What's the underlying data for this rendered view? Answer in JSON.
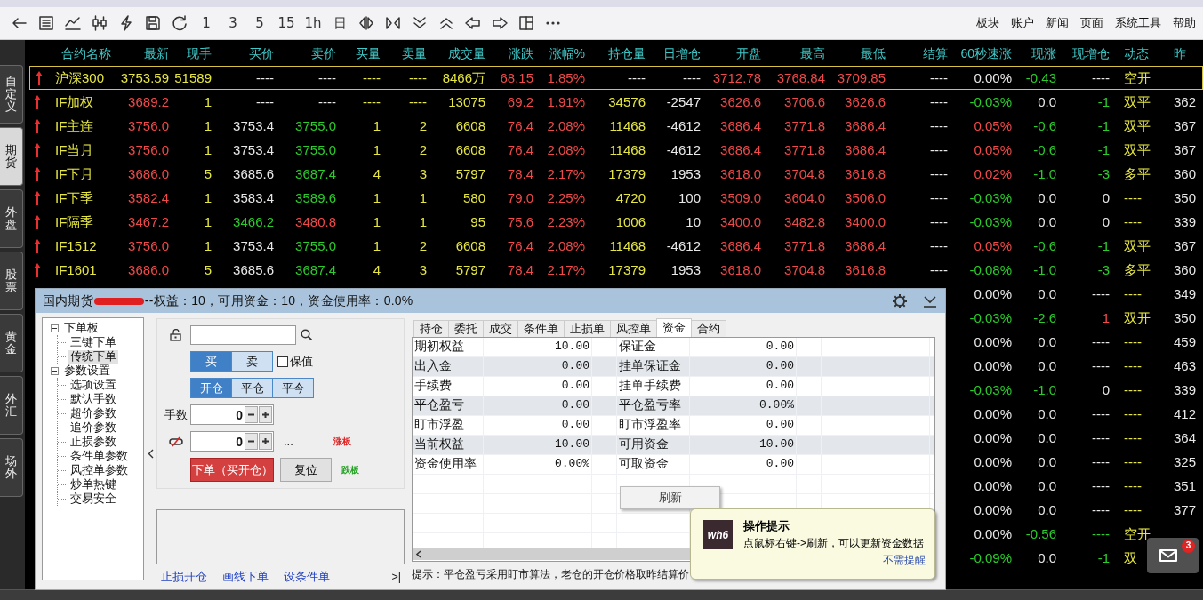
{
  "toolbar": {
    "periods": [
      "1",
      "3",
      "5",
      "15",
      "1h",
      "日"
    ],
    "menu": [
      "板块",
      "账户",
      "新闻",
      "页面",
      "系统工具",
      "帮助"
    ]
  },
  "side_tabs": [
    {
      "label": "自定义",
      "selected": false
    },
    {
      "label": "期货",
      "selected": true
    },
    {
      "label": "外盘",
      "selected": false
    },
    {
      "label": "股票",
      "selected": false
    },
    {
      "label": "黄金",
      "selected": false
    },
    {
      "label": "外汇",
      "selected": false
    },
    {
      "label": "场外",
      "selected": false
    }
  ],
  "quotes": {
    "columns": [
      {
        "label": "合约名称",
        "color": "#e6e642"
      },
      {
        "label": "最新",
        "color": "#f04a4a"
      },
      {
        "label": "现手",
        "color": "#e6e642"
      },
      {
        "label": "买价",
        "color": "#e8e8e8"
      },
      {
        "label": "卖价",
        "color": "#2ccc2c"
      },
      {
        "label": "买量",
        "color": "#e6e642"
      },
      {
        "label": "卖量",
        "color": "#e6e642"
      },
      {
        "label": "成交量",
        "color": "#e6e642"
      },
      {
        "label": "涨跌",
        "color": "#f04a4a"
      },
      {
        "label": "涨幅%",
        "color": "#f04a4a"
      },
      {
        "label": "持仓量",
        "color": "#e6e642"
      },
      {
        "label": "日增仓",
        "color": "#e8e8e8"
      },
      {
        "label": "开盘",
        "color": "#f04a4a"
      },
      {
        "label": "最高",
        "color": "#f04a4a"
      },
      {
        "label": "最低",
        "color": "#f04a4a"
      },
      {
        "label": "结算",
        "color": "#e8e8e8"
      },
      {
        "label": "60秒速涨",
        "color": "#e8e8e8"
      },
      {
        "label": "现涨",
        "color": "#e8e8e8"
      },
      {
        "label": "现增仓",
        "color": "#e8e8e8"
      },
      {
        "label": "动态",
        "color": "#e6e642"
      },
      {
        "label": "昨",
        "color": "#e8e8e8"
      }
    ],
    "rows": [
      {
        "selected": true,
        "kind": "rising",
        "cells": [
          "沪深300",
          {
            "text": "3753.59",
            "color": "#e6e642"
          },
          "51589",
          "----",
          {
            "text": "----",
            "color": "#e8e8e8"
          },
          "----",
          "----",
          "8466万",
          "68.15",
          "1.85%",
          {
            "text": "----",
            "color": "#e8e8e8"
          },
          "----",
          "3712.78",
          "3768.84",
          "3709.85",
          "----",
          "0.00%",
          {
            "text": "-0.43",
            "color": "#2ccc2c"
          },
          "----",
          "空开"
        ]
      },
      {
        "selected": false,
        "kind": "rising",
        "cells": [
          "IF加权",
          "3689.2",
          "1",
          "----",
          {
            "text": "----",
            "color": "#e8e8e8"
          },
          "----",
          "----",
          "13075",
          "69.2",
          "1.91%",
          "34576",
          "-2547",
          "3626.6",
          "3706.6",
          "3626.6",
          "----",
          {
            "text": "-0.03%",
            "color": "#2ccc2c"
          },
          "0.0",
          {
            "text": "-1",
            "color": "#2ccc2c"
          },
          "双平",
          "362"
        ]
      },
      {
        "selected": false,
        "kind": "rising",
        "cells": [
          "IF主连",
          "3756.0",
          "1",
          "3753.4",
          "3755.0",
          "1",
          "2",
          "6608",
          "76.4",
          "2.08%",
          "11468",
          "-4612",
          "3686.4",
          "3771.8",
          "3686.4",
          "----",
          {
            "text": "0.05%",
            "color": "#f04a4a"
          },
          {
            "text": "-0.6",
            "color": "#2ccc2c"
          },
          {
            "text": "-1",
            "color": "#2ccc2c"
          },
          "双平",
          "367"
        ]
      },
      {
        "selected": false,
        "kind": "rising",
        "cells": [
          "IF当月",
          "3756.0",
          "1",
          "3753.4",
          "3755.0",
          "1",
          "2",
          "6608",
          "76.4",
          "2.08%",
          "11468",
          "-4612",
          "3686.4",
          "3771.8",
          "3686.4",
          "----",
          {
            "text": "0.05%",
            "color": "#f04a4a"
          },
          {
            "text": "-0.6",
            "color": "#2ccc2c"
          },
          {
            "text": "-1",
            "color": "#2ccc2c"
          },
          "双平",
          "367"
        ]
      },
      {
        "selected": false,
        "kind": "rising",
        "cells": [
          "IF下月",
          "3686.0",
          "5",
          "3685.6",
          "3687.4",
          "4",
          "3",
          "5797",
          "78.4",
          "2.17%",
          "17379",
          "1953",
          "3618.0",
          "3704.8",
          "3616.8",
          "----",
          {
            "text": "0.02%",
            "color": "#f04a4a"
          },
          {
            "text": "-1.0",
            "color": "#2ccc2c"
          },
          {
            "text": "-3",
            "color": "#2ccc2c"
          },
          "多平",
          "360"
        ]
      },
      {
        "selected": false,
        "kind": "rising",
        "cells": [
          "IF下季",
          "3582.4",
          "1",
          "3583.4",
          "3589.6",
          "1",
          "1",
          "580",
          "79.0",
          "2.25%",
          "4720",
          "100",
          "3509.0",
          "3604.0",
          "3506.0",
          "----",
          {
            "text": "-0.03%",
            "color": "#2ccc2c"
          },
          "0.0",
          "0",
          "----",
          "350"
        ]
      },
      {
        "selected": false,
        "kind": "rising",
        "cells": [
          "IF隔季",
          "3467.2",
          "1",
          {
            "text": "3466.2",
            "color": "#2ccc2c"
          },
          {
            "text": "3480.8",
            "color": "#f04a4a"
          },
          "1",
          "1",
          "95",
          "75.6",
          "2.23%",
          "1006",
          "10",
          "3400.0",
          "3482.8",
          "3400.0",
          "----",
          {
            "text": "-0.03%",
            "color": "#2ccc2c"
          },
          "0.0",
          "0",
          "----",
          "339"
        ]
      },
      {
        "selected": false,
        "kind": "rising",
        "cells": [
          "IF1512",
          "3756.0",
          "1",
          "3753.4",
          "3755.0",
          "1",
          "2",
          "6608",
          "76.4",
          "2.08%",
          "11468",
          "-4612",
          "3686.4",
          "3771.8",
          "3686.4",
          "----",
          {
            "text": "0.05%",
            "color": "#f04a4a"
          },
          {
            "text": "-0.6",
            "color": "#2ccc2c"
          },
          {
            "text": "-1",
            "color": "#2ccc2c"
          },
          "双平",
          "367"
        ]
      },
      {
        "selected": false,
        "kind": "rising",
        "cells": [
          "IF1601",
          "3686.0",
          "5",
          "3685.6",
          "3687.4",
          "4",
          "3",
          "5797",
          "78.4",
          "2.17%",
          "17379",
          "1953",
          "3618.0",
          "3704.8",
          "3616.8",
          "----",
          {
            "text": "-0.08%",
            "color": "#2ccc2c"
          },
          {
            "text": "-1.0",
            "color": "#2ccc2c"
          },
          {
            "text": "-3",
            "color": "#2ccc2c"
          },
          "多平",
          "360"
        ]
      }
    ],
    "rows_behind_dialog": [
      {
        "cells": [
          "0.00%",
          "0.0",
          "----",
          "----",
          "349"
        ]
      },
      {
        "cells": [
          {
            "text": "-0.03%",
            "color": "#2ccc2c"
          },
          {
            "text": "-2.6",
            "color": "#2ccc2c"
          },
          {
            "text": "1",
            "color": "#f04a4a"
          },
          "双开",
          "350"
        ]
      },
      {
        "cells": [
          "0.00%",
          "0.0",
          "----",
          "----",
          "459"
        ]
      },
      {
        "cells": [
          "0.00%",
          "0.0",
          "----",
          "----",
          "463"
        ]
      },
      {
        "cells": [
          {
            "text": "-0.03%",
            "color": "#2ccc2c"
          },
          {
            "text": "-1.0",
            "color": "#2ccc2c"
          },
          "0",
          "----",
          "339"
        ]
      },
      {
        "cells": [
          "0.00%",
          "0.0",
          "----",
          "----",
          "412"
        ]
      },
      {
        "cells": [
          "0.00%",
          "0.0",
          "----",
          "----",
          "364"
        ]
      },
      {
        "cells": [
          "0.00%",
          "0.0",
          "----",
          "----",
          "325"
        ]
      },
      {
        "cells": [
          "0.00%",
          "0.0",
          "----",
          "----",
          "351"
        ]
      },
      {
        "cells": [
          "0.00%",
          "0.0",
          "----",
          "----",
          "377"
        ]
      },
      {
        "cells": [
          "0.00%",
          {
            "text": "-0.56",
            "color": "#2ccc2c"
          },
          {
            "text": "----",
            "color": "#2ccc2c"
          },
          "空开"
        ]
      },
      {
        "cells": [
          {
            "text": "-0.09%",
            "color": "#2ccc2c"
          },
          "0.0",
          {
            "text": "-1",
            "color": "#2ccc2c"
          },
          "双"
        ]
      }
    ]
  },
  "dialog": {
    "title_prefix": "国内期货",
    "title_suffix": "--权益：10，可用资金：10，资金使用率：0.0%",
    "tree": [
      {
        "label": "下单板",
        "expanded": true,
        "children": [
          {
            "label": "三键下单",
            "selected": false
          },
          {
            "label": "传统下单",
            "selected": true
          }
        ]
      },
      {
        "label": "参数设置",
        "expanded": true,
        "children": [
          {
            "label": "选项设置",
            "selected": false
          },
          {
            "label": "默认手数",
            "selected": false
          },
          {
            "label": "超价参数",
            "selected": false
          },
          {
            "label": "追价参数",
            "selected": false
          },
          {
            "label": "止损参数",
            "selected": false
          },
          {
            "label": "条件单参数",
            "selected": false
          },
          {
            "label": "风控单参数",
            "selected": false
          },
          {
            "label": "炒单热键",
            "selected": false
          },
          {
            "label": "交易安全",
            "selected": false
          }
        ]
      }
    ],
    "order": {
      "direction": [
        {
          "label": "买",
          "selected": true
        },
        {
          "label": "卖",
          "selected": false
        }
      ],
      "hedge": {
        "label": "保值",
        "checked": false
      },
      "offset": [
        {
          "label": "开仓",
          "selected": true
        },
        {
          "label": "平仓",
          "selected": false
        },
        {
          "label": "平今",
          "selected": false
        }
      ],
      "qty_label": "手数",
      "qty": "0",
      "price": "0",
      "price_more": "...",
      "limit_up": "涨板",
      "limit_down": "跌板",
      "submit": "下单（买开仓）",
      "reset": "复位"
    },
    "links": [
      "止损开仓",
      "画线下单",
      "设条件单"
    ],
    "jump": ">|",
    "tabs": [
      {
        "label": "持仓",
        "selected": false
      },
      {
        "label": "委托",
        "selected": false
      },
      {
        "label": "成交",
        "selected": false
      },
      {
        "label": "条件单",
        "selected": false
      },
      {
        "label": "止损单",
        "selected": false
      },
      {
        "label": "风控单",
        "selected": false
      },
      {
        "label": "资金",
        "selected": true
      },
      {
        "label": "合约",
        "selected": false
      }
    ],
    "funds": [
      [
        "期初权益",
        "10.00",
        "保证金",
        "0.00"
      ],
      [
        "出入金",
        "0.00",
        "挂单保证金",
        "0.00"
      ],
      [
        "手续费",
        "0.00",
        "挂单手续费",
        "0.00"
      ],
      [
        "平仓盈亏",
        "0.00",
        "平仓盈亏率",
        "0.00%"
      ],
      [
        "盯市浮盈",
        "0.00",
        "盯市浮盈率",
        "0.00"
      ],
      [
        "当前权益",
        "10.00",
        "可用资金",
        "10.00"
      ],
      [
        "资金使用率",
        "0.00%",
        "可取资金",
        "0.00"
      ]
    ],
    "hint": "提示：平仓盈亏采用盯市算法，老仓的开仓价格取昨结算价",
    "menu": [
      "刷新"
    ]
  },
  "toast": {
    "logo": "wh6",
    "title": "操作提示",
    "message": "点鼠标右键->刷新，可以更新资金数据",
    "dismiss": "不需提醒"
  },
  "mail": {
    "count": "3"
  }
}
